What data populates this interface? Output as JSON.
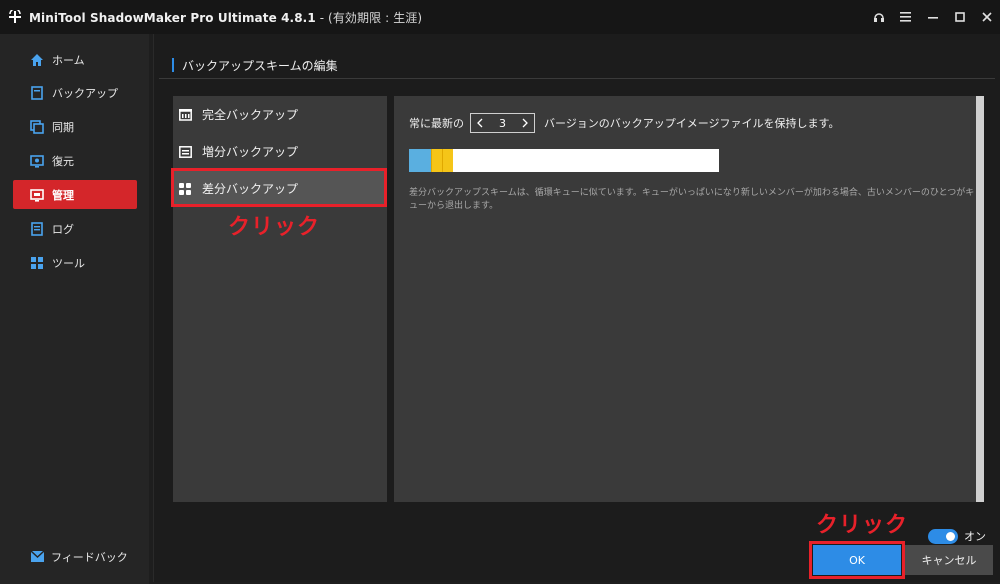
{
  "titlebar": {
    "app_name": "MiniTool ShadowMaker Pro Ultimate 4.8.1",
    "license": " - (有効期限 : 生涯)"
  },
  "sidebar": {
    "items": [
      {
        "label": "ホーム",
        "icon": "home-icon"
      },
      {
        "label": "バックアップ",
        "icon": "backup-icon"
      },
      {
        "label": "同期",
        "icon": "sync-icon"
      },
      {
        "label": "復元",
        "icon": "restore-icon"
      },
      {
        "label": "管理",
        "icon": "manage-icon",
        "active": true
      },
      {
        "label": "ログ",
        "icon": "log-icon"
      },
      {
        "label": "ツール",
        "icon": "tools-icon"
      }
    ],
    "feedback_label": "フィードバック"
  },
  "main": {
    "section_title": "バックアップスキームの編集",
    "schemes": [
      {
        "label": "完全バックアップ",
        "icon": "full-backup-icon"
      },
      {
        "label": "増分バックアップ",
        "icon": "incremental-backup-icon"
      },
      {
        "label": "差分バックアップ",
        "icon": "differential-backup-icon",
        "selected": true
      }
    ],
    "annotation_click": "クリック",
    "detail": {
      "keep_prefix": "常に最新の",
      "keep_value": "3",
      "keep_suffix": "バージョンのバックアップイメージファイルを保持します。",
      "description": "差分バックアップスキームは、循環キューに似ています。キューがいっぱいになり新しいメンバーが加わる場合、古いメンバーのひとつがキューから退出します。"
    }
  },
  "footer": {
    "toggle_label": "オン",
    "toggle_on": true,
    "ok_label": "OK",
    "cancel_label": "キャンセル",
    "annotation_click": "クリック"
  },
  "colors": {
    "accent_blue": "#2d8ce6",
    "active_red": "#d4262a",
    "annotation_red": "#e8212a",
    "version_full": "#5aafe0",
    "version_diff": "#f5c518"
  }
}
